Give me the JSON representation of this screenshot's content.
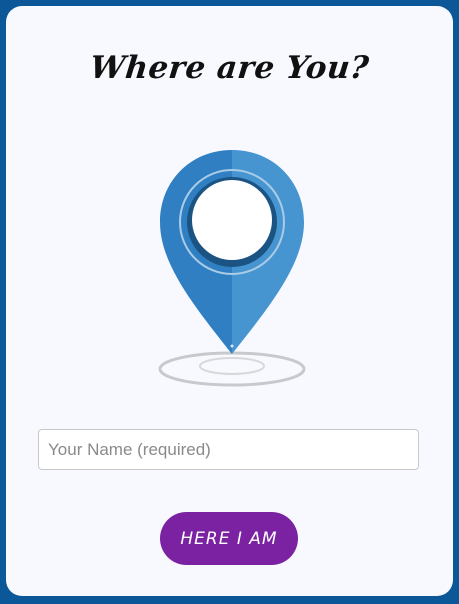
{
  "page": {
    "title": "Where are You?"
  },
  "form": {
    "name_placeholder": "Your Name (required)",
    "name_value": "",
    "submit_label": "HERE I AM"
  },
  "illustration": {
    "icon": "location-pin-icon"
  },
  "colors": {
    "frame": "#0b5797",
    "card": "#f8f9fe",
    "pin_blue": "#3c8ccb",
    "button": "#7b22a3"
  }
}
